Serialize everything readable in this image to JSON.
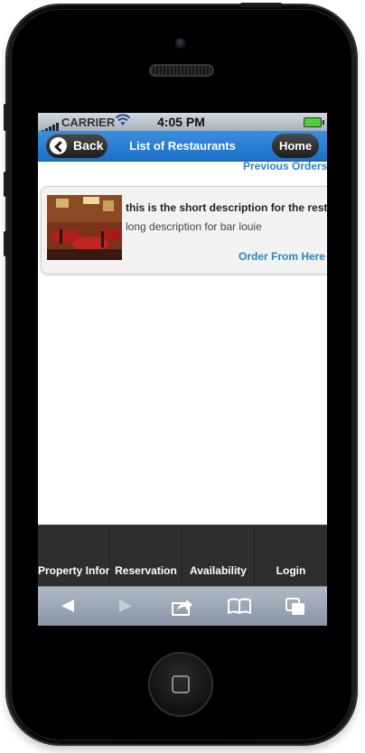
{
  "status_bar": {
    "carrier": "CARRIER",
    "time": "4:05 PM"
  },
  "header": {
    "back_label": "Back",
    "title": "List of Restaurants",
    "home_label": "Home"
  },
  "previous_orders_link": "Previous Orders",
  "restaurants": [
    {
      "short_description": "this is the short description for the restaurant",
      "long_description": "long description for bar louie",
      "order_link": "Order From Here"
    }
  ],
  "tabs": [
    {
      "label": "Property Information"
    },
    {
      "label": "Reservation"
    },
    {
      "label": "Availability"
    },
    {
      "label": "Login"
    }
  ],
  "browser_toolbar": {
    "icons": [
      "back-arrow-icon",
      "forward-arrow-icon",
      "share-icon",
      "bookmarks-icon",
      "tabs-icon"
    ]
  },
  "colors": {
    "header_blue": "#1c6fc8",
    "link_blue": "#2b85c8",
    "tabbar": "#2e2e2e"
  }
}
